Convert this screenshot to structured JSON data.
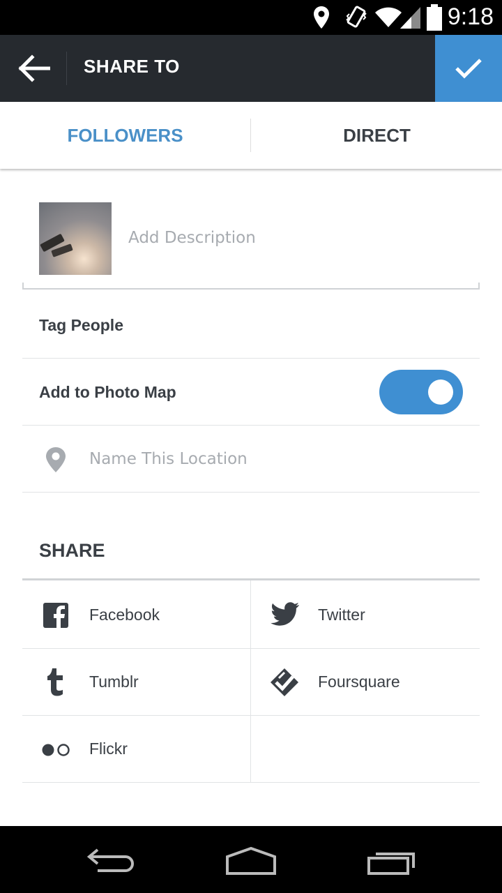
{
  "status_bar": {
    "time": "9:18",
    "icons": [
      "location-pin-icon",
      "vibrate-icon",
      "wifi-icon",
      "signal-icon",
      "battery-icon"
    ]
  },
  "app_bar": {
    "title": "SHARE TO",
    "back_icon": "back-arrow-icon",
    "confirm_icon": "checkmark-icon",
    "accent_color": "#3f8fd2"
  },
  "tabs": [
    {
      "label": "FOLLOWERS",
      "active": true
    },
    {
      "label": "DIRECT",
      "active": false
    }
  ],
  "post": {
    "description_placeholder": "Add Description"
  },
  "options": {
    "tag_people": "Tag People",
    "photo_map": "Add to Photo Map",
    "photo_map_on": true,
    "location_placeholder": "Name This Location"
  },
  "share": {
    "heading": "SHARE",
    "services": [
      {
        "label": "Facebook",
        "icon": "facebook-icon"
      },
      {
        "label": "Twitter",
        "icon": "twitter-icon"
      },
      {
        "label": "Tumblr",
        "icon": "tumblr-icon"
      },
      {
        "label": "Foursquare",
        "icon": "foursquare-icon"
      },
      {
        "label": "Flickr",
        "icon": "flickr-icon"
      }
    ]
  },
  "nav_bar": {
    "icons": [
      "back-nav-icon",
      "home-nav-icon",
      "recents-nav-icon"
    ]
  }
}
